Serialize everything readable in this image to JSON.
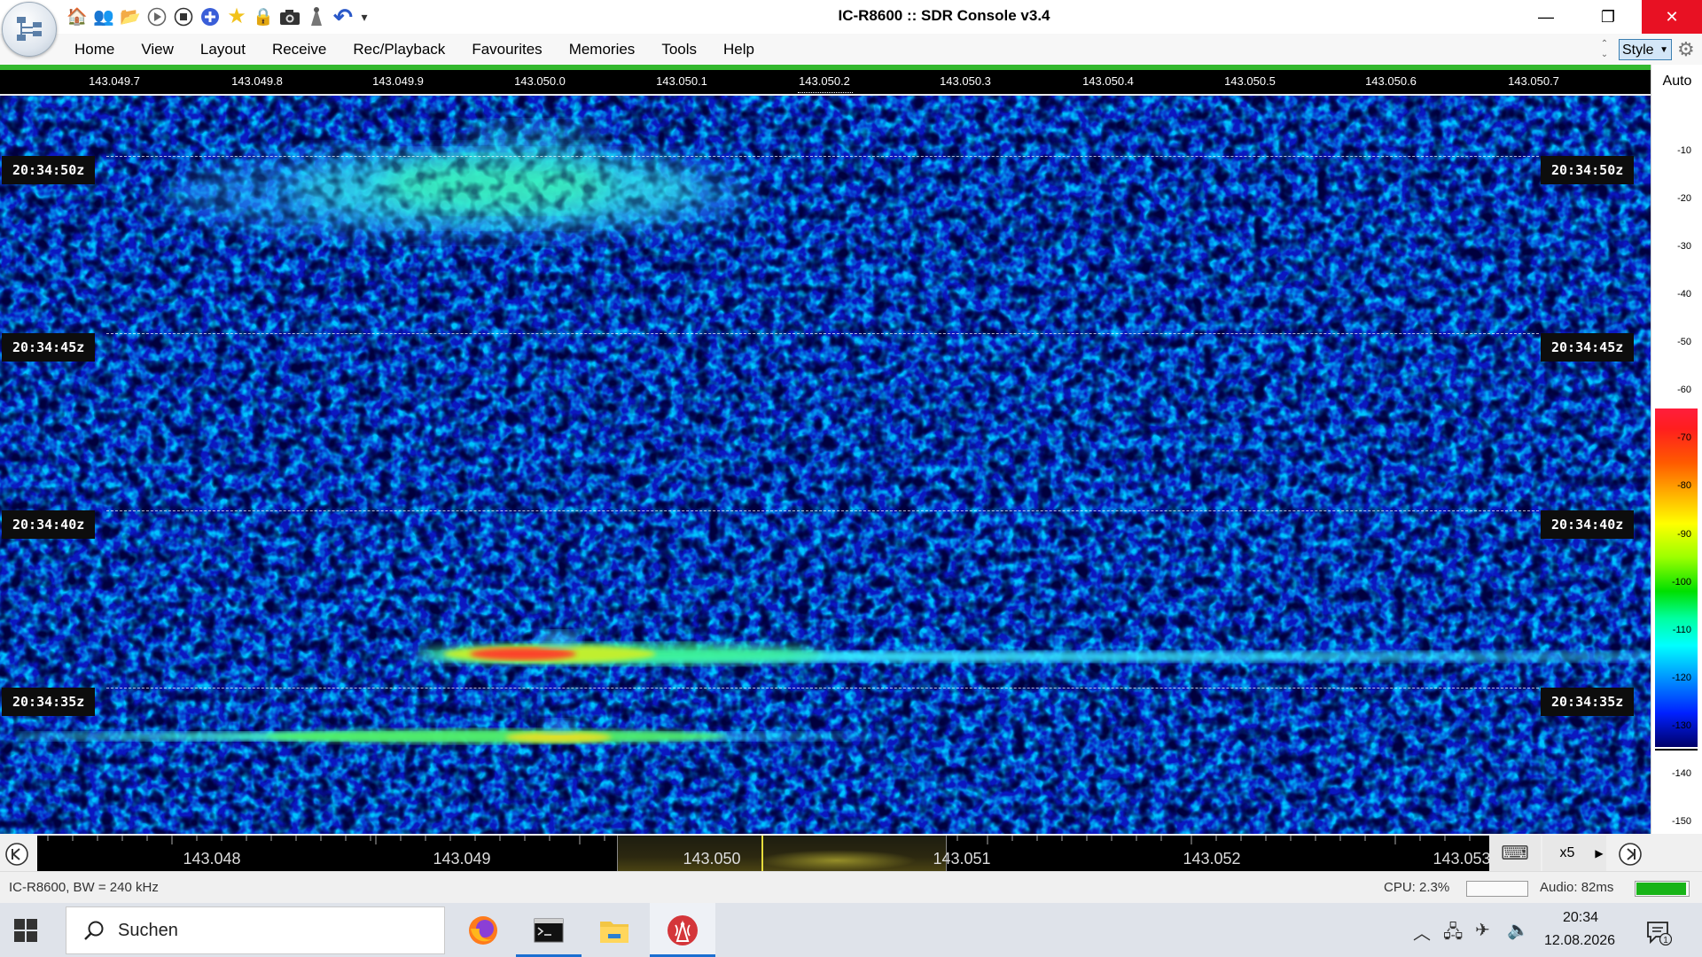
{
  "window": {
    "title": "IC-R8600 :: SDR Console v3.4",
    "minimize_glyph": "—",
    "restore_glyph": "❐",
    "close_glyph": "✕"
  },
  "quick_tools": [
    {
      "name": "home-icon",
      "glyph": "🏠"
    },
    {
      "name": "users-icon",
      "glyph": "👥"
    },
    {
      "name": "folder-icon",
      "glyph": "📂"
    },
    {
      "name": "play-icon",
      "glyph": "▶"
    },
    {
      "name": "stop-icon",
      "glyph": "⏹"
    },
    {
      "name": "add-icon",
      "glyph": "⊕"
    },
    {
      "name": "star-icon",
      "glyph": "★"
    },
    {
      "name": "lock-icon",
      "glyph": "🔒"
    },
    {
      "name": "camera-icon",
      "glyph": "📷"
    },
    {
      "name": "antenna-icon",
      "glyph": "⛛"
    },
    {
      "name": "undo-icon",
      "glyph": "↶"
    },
    {
      "name": "customize-icon",
      "glyph": "▾"
    }
  ],
  "menu": [
    "Home",
    "View",
    "Layout",
    "Receive",
    "Rec/Playback",
    "Favourites",
    "Memories",
    "Tools",
    "Help"
  ],
  "style_selector": {
    "value": "Style"
  },
  "freq_scale_top": [
    "143.049.7",
    "143.049.8",
    "143.049.9",
    "143.050.0",
    "143.050.1",
    "143.050.2",
    "143.050.3",
    "143.050.4",
    "143.050.5",
    "143.050.6",
    "143.050.7"
  ],
  "waterfall": {
    "time_markers": [
      "20:34:50z",
      "20:34:45z",
      "20:34:40z",
      "20:34:35z"
    ],
    "background_color": "#0b18c0"
  },
  "db_scale": {
    "auto_label": "Auto",
    "ticks": [
      "-10",
      "-20",
      "-30",
      "-40",
      "-50",
      "-60",
      "-70",
      "-80",
      "-90",
      "-100",
      "-110",
      "-120",
      "-130",
      "-140",
      "-150"
    ]
  },
  "bottom_scale": {
    "ticks": [
      "143.048",
      "143.049",
      "143.050",
      "143.051",
      "143.052",
      "143.053"
    ],
    "zoom": "x5"
  },
  "status": {
    "device": "IC-R8600, BW = 240 kHz",
    "cpu": "CPU: 2.3%",
    "cpu_fraction": 0.0,
    "audio": "Audio: 82ms",
    "audio_fraction": 0.97,
    "audio_color": "#18b418"
  },
  "taskbar": {
    "search_placeholder": "Suchen",
    "apps": [
      "firefox-icon",
      "terminal-icon",
      "file-explorer-icon",
      "sdr-console-icon"
    ],
    "time": "20:34",
    "date": "12.08.2026",
    "notification_count": "1",
    "accent": "#1c6fd1"
  }
}
